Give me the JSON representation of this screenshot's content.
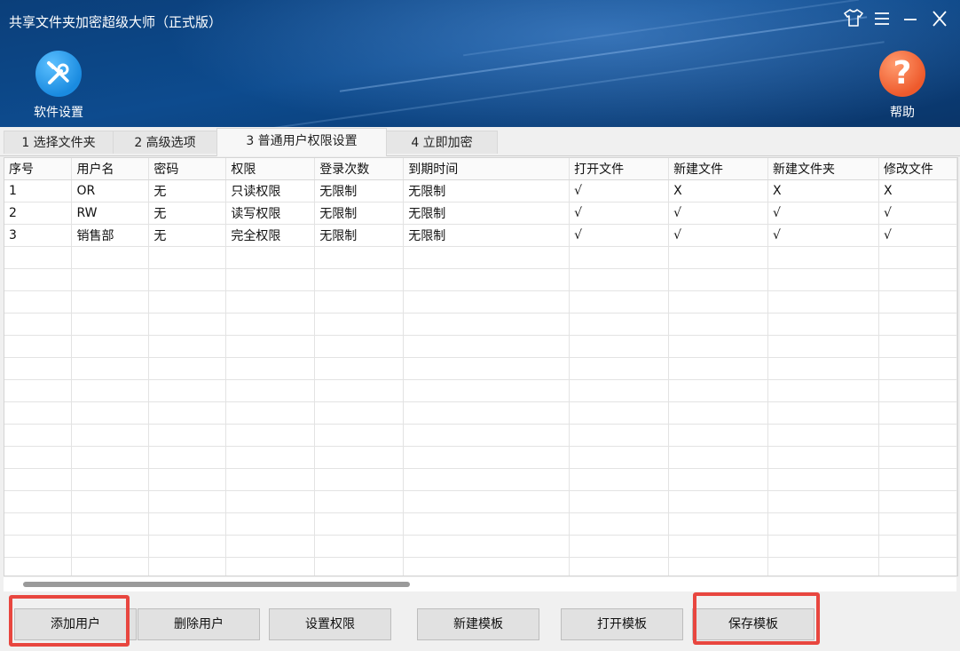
{
  "window": {
    "title": "共享文件夹加密超级大师（正式版）"
  },
  "toolbar": {
    "settings_label": "软件设置",
    "help_label": "帮助"
  },
  "tabs": [
    {
      "label": "1 选择文件夹"
    },
    {
      "label": "2 高级选项"
    },
    {
      "label": "3 普通用户权限设置"
    },
    {
      "label": "4 立即加密"
    }
  ],
  "table": {
    "headers": [
      "序号",
      "用户名",
      "密码",
      "权限",
      "登录次数",
      "到期时间",
      "打开文件",
      "新建文件",
      "新建文件夹",
      "修改文件"
    ],
    "rows": [
      [
        "1",
        "OR",
        "无",
        "只读权限",
        "无限制",
        "无限制",
        "√",
        "X",
        "X",
        "X"
      ],
      [
        "2",
        "RW",
        "无",
        "读写权限",
        "无限制",
        "无限制",
        "√",
        "√",
        "√",
        "√"
      ],
      [
        "3",
        "销售部",
        "无",
        "完全权限",
        "无限制",
        "无限制",
        "√",
        "√",
        "√",
        "√"
      ]
    ]
  },
  "buttons": {
    "add_user": "添加用户",
    "delete_user": "删除用户",
    "set_permission": "设置权限",
    "new_template": "新建模板",
    "open_template": "打开模板",
    "save_template": "保存模板"
  },
  "colors": {
    "highlight": "#e8463f",
    "header_bg": "#0d4b8e",
    "settings_icon": "#2a9be8",
    "help_icon": "#f26a3d"
  }
}
